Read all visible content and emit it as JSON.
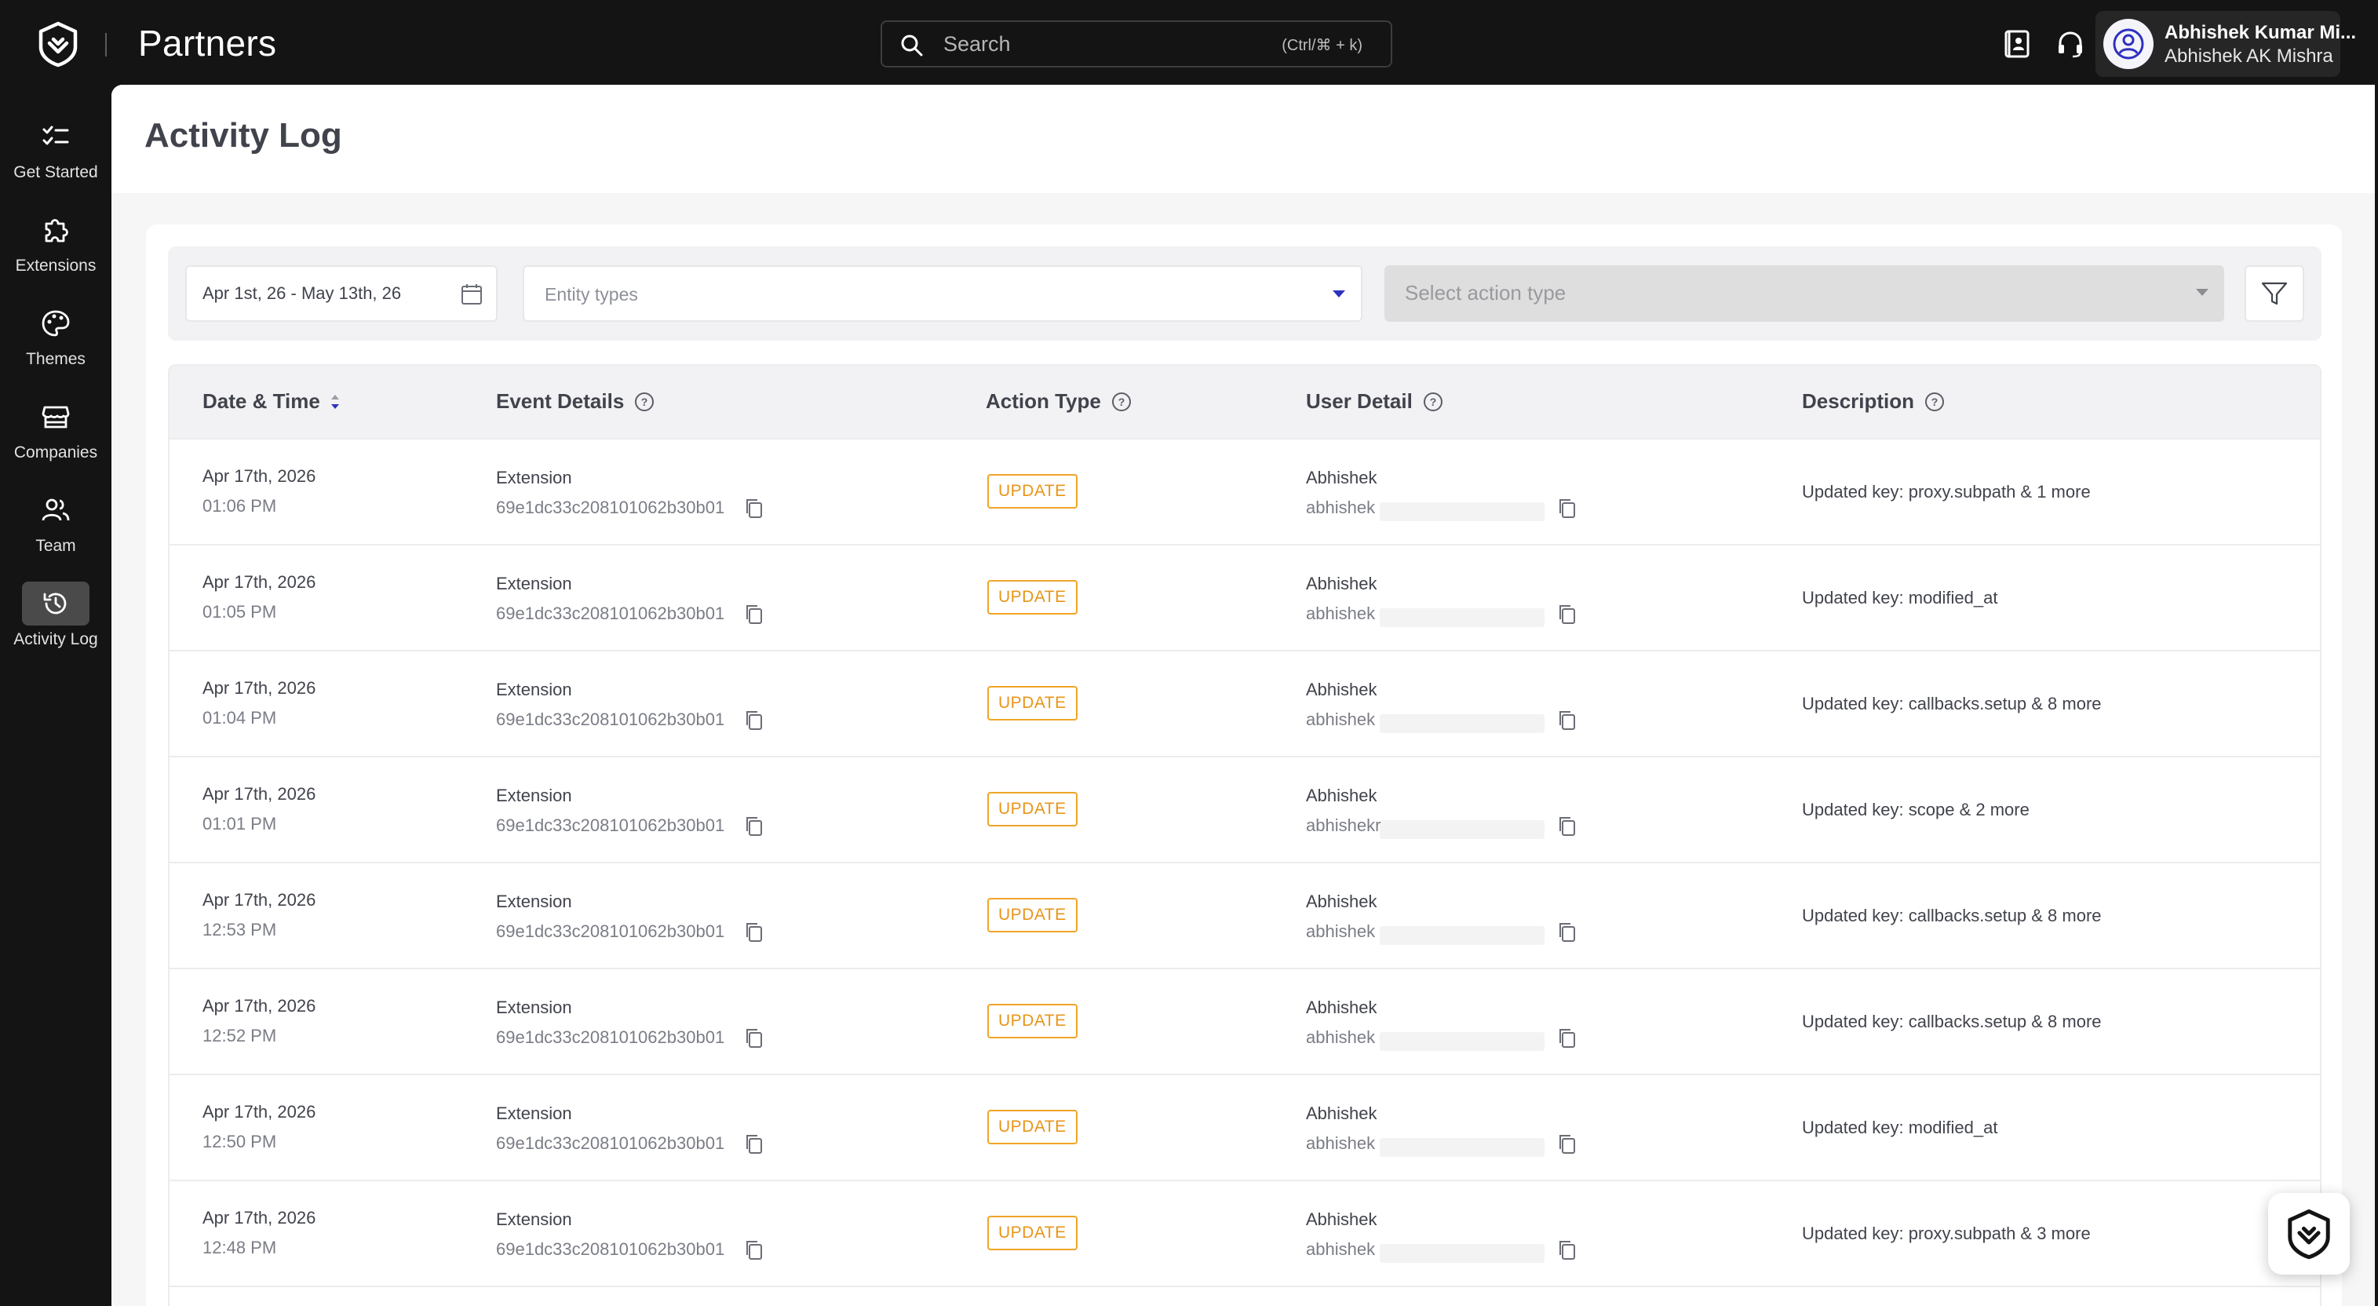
{
  "app": {
    "brand": "Partners"
  },
  "search": {
    "placeholder": "Search",
    "shortcut": "(Ctrl/⌘ + k)"
  },
  "user": {
    "name": "Abhishek Kumar Mi...",
    "subtitle": "Abhishek AK Mishra"
  },
  "sidebar": {
    "items": [
      {
        "label": "Get Started",
        "icon": "checklist-icon"
      },
      {
        "label": "Extensions",
        "icon": "puzzle-icon"
      },
      {
        "label": "Themes",
        "icon": "palette-icon"
      },
      {
        "label": "Companies",
        "icon": "store-icon"
      },
      {
        "label": "Team",
        "icon": "people-icon"
      },
      {
        "label": "Activity Log",
        "icon": "history-icon",
        "active": true
      }
    ]
  },
  "page": {
    "title": "Activity Log"
  },
  "filters": {
    "date_range": "Apr 1st, 26 - May 13th, 26",
    "entity_placeholder": "Entity types",
    "action_placeholder": "Select action type"
  },
  "table": {
    "headers": {
      "datetime": "Date & Time",
      "event": "Event Details",
      "action": "Action Type",
      "user": "User Detail",
      "description": "Description"
    },
    "rows": [
      {
        "date": "Apr 17th, 2026",
        "time": "01:06 PM",
        "entity": "Extension",
        "id": "69e1dc33c208101062b30b01",
        "action": "UPDATE",
        "user_name": "Abhishek",
        "user_email": "abhishek",
        "description": "Updated key: proxy.subpath & 1 more"
      },
      {
        "date": "Apr 17th, 2026",
        "time": "01:05 PM",
        "entity": "Extension",
        "id": "69e1dc33c208101062b30b01",
        "action": "UPDATE",
        "user_name": "Abhishek",
        "user_email": "abhishek",
        "description": "Updated key: modified_at"
      },
      {
        "date": "Apr 17th, 2026",
        "time": "01:04 PM",
        "entity": "Extension",
        "id": "69e1dc33c208101062b30b01",
        "action": "UPDATE",
        "user_name": "Abhishek",
        "user_email": "abhishek",
        "description": "Updated key: callbacks.setup & 8 more"
      },
      {
        "date": "Apr 17th, 2026",
        "time": "01:01 PM",
        "entity": "Extension",
        "id": "69e1dc33c208101062b30b01",
        "action": "UPDATE",
        "user_name": "Abhishek",
        "user_email": "abhishekr",
        "description": "Updated key: scope & 2 more"
      },
      {
        "date": "Apr 17th, 2026",
        "time": "12:53 PM",
        "entity": "Extension",
        "id": "69e1dc33c208101062b30b01",
        "action": "UPDATE",
        "user_name": "Abhishek",
        "user_email": "abhishek",
        "description": "Updated key: callbacks.setup & 8 more"
      },
      {
        "date": "Apr 17th, 2026",
        "time": "12:52 PM",
        "entity": "Extension",
        "id": "69e1dc33c208101062b30b01",
        "action": "UPDATE",
        "user_name": "Abhishek",
        "user_email": "abhishek",
        "description": "Updated key: callbacks.setup & 8 more"
      },
      {
        "date": "Apr 17th, 2026",
        "time": "12:50 PM",
        "entity": "Extension",
        "id": "69e1dc33c208101062b30b01",
        "action": "UPDATE",
        "user_name": "Abhishek",
        "user_email": "abhishek",
        "description": "Updated key: modified_at"
      },
      {
        "date": "Apr 17th, 2026",
        "time": "12:48 PM",
        "entity": "Extension",
        "id": "69e1dc33c208101062b30b01",
        "action": "UPDATE",
        "user_name": "Abhishek",
        "user_email": "abhishek",
        "description": "Updated key: proxy.subpath & 3 more"
      }
    ]
  },
  "colors": {
    "accent": "#2e31be",
    "badge_update": "#e8951a",
    "dark": "#141414"
  }
}
